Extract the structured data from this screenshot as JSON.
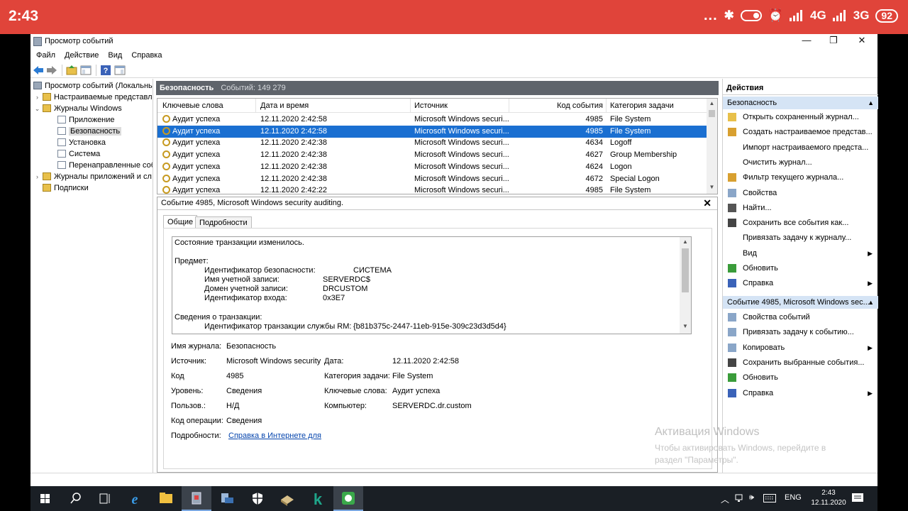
{
  "phone": {
    "time": "2:43",
    "dots": "...",
    "net1": "4G",
    "net2": "3G",
    "battery": "92"
  },
  "window": {
    "title": "Просмотр событий",
    "minimize": "—",
    "restore": "❐",
    "close": "✕",
    "menu": [
      "Файл",
      "Действие",
      "Вид",
      "Справка"
    ]
  },
  "tree": {
    "root": "Просмотр событий (Локальнь",
    "custom_views": "Настраиваемые представле",
    "windows_logs": "Журналы Windows",
    "application": "Приложение",
    "security": "Безопасность",
    "setup": "Установка",
    "system": "Система",
    "forwarded": "Перенаправленные соб",
    "app_logs": "Журналы приложений и сл",
    "subscriptions": "Подписки"
  },
  "center": {
    "log_name": "Безопасность",
    "events_count": "Событий: 149 279",
    "columns": [
      "Ключевые слова",
      "Дата и время",
      "Источник",
      "Код события",
      "Категория задачи"
    ],
    "rows": [
      {
        "kw": "Аудит успеха",
        "dt": "12.11.2020 2:42:58",
        "src": "Microsoft Windows securi...",
        "id": "4985",
        "cat": "File System"
      },
      {
        "kw": "Аудит успеха",
        "dt": "12.11.2020 2:42:58",
        "src": "Microsoft Windows securi...",
        "id": "4985",
        "cat": "File System"
      },
      {
        "kw": "Аудит успеха",
        "dt": "12.11.2020 2:42:38",
        "src": "Microsoft Windows securi...",
        "id": "4634",
        "cat": "Logoff"
      },
      {
        "kw": "Аудит успеха",
        "dt": "12.11.2020 2:42:38",
        "src": "Microsoft Windows securi...",
        "id": "4627",
        "cat": "Group Membership"
      },
      {
        "kw": "Аудит успеха",
        "dt": "12.11.2020 2:42:38",
        "src": "Microsoft Windows securi...",
        "id": "4624",
        "cat": "Logon"
      },
      {
        "kw": "Аудит успеха",
        "dt": "12.11.2020 2:42:38",
        "src": "Microsoft Windows securi...",
        "id": "4672",
        "cat": "Special Logon"
      },
      {
        "kw": "Аудит успеха",
        "dt": "12.11.2020 2:42:22",
        "src": "Microsoft Windows securi...",
        "id": "4985",
        "cat": "File System"
      }
    ]
  },
  "detail": {
    "title": "Событие 4985, Microsoft Windows security auditing.",
    "close": "✕",
    "tab_general": "Общие",
    "tab_details": "Подробности",
    "message": {
      "line1": "Состояние транзакции изменилось.",
      "subject": "Предмет:",
      "sid_label": "Идентификатор безопасности:",
      "sid_value": "СИСТЕМА",
      "account_label": "Имя учетной записи:",
      "account_value": "SERVERDC$",
      "domain_label": "Домен учетной записи:",
      "domain_value": "DRCUSTOM",
      "logon_label": "Идентификатор входа:",
      "logon_value": "0x3E7",
      "tx_info": "Сведения о транзакции:",
      "tx_label": "Идентификатор транзакции службы RM:",
      "tx_value": "{b81b375c-2447-11eb-915e-309c23d3d5d4}"
    },
    "props": {
      "log_name_label": "Имя журнала:",
      "log_name_value": "Безопасность",
      "source_label": "Источник:",
      "source_value": "Microsoft Windows security",
      "date_label": "Дата:",
      "date_value": "12.11.2020 2:42:58",
      "code_label": "Код",
      "code_value": "4985",
      "category_label": "Категория задачи:",
      "category_value": "File System",
      "level_label": "Уровень:",
      "level_value": "Сведения",
      "keywords_label": "Ключевые слова:",
      "keywords_value": "Аудит успеха",
      "user_label": "Пользов.:",
      "user_value": "Н/Д",
      "computer_label": "Компьютер:",
      "computer_value": "SERVERDC.dr.custom",
      "opcode_label": "Код операции:",
      "opcode_value": "Сведения",
      "more_label": "Подробности:",
      "more_link": "Справка в Интернете для"
    }
  },
  "actions": {
    "title": "Действия",
    "section1": "Безопасность",
    "items1": [
      "Открыть сохраненный журнал...",
      "Создать настраиваемое представ...",
      "Импорт настраиваемого предста...",
      "Очистить журнал...",
      "Фильтр текущего журнала...",
      "Свойства",
      "Найти...",
      "Сохранить все события как...",
      "Привязать задачу к журналу...",
      "Вид",
      "Обновить",
      "Справка"
    ],
    "section2": "Событие 4985, Microsoft Windows sec...",
    "items2": [
      "Свойства событий",
      "Привязать задачу к событию...",
      "Копировать",
      "Сохранить выбранные события...",
      "Обновить",
      "Справка"
    ]
  },
  "watermark": {
    "title": "Активация Windows",
    "line1": "Чтобы активировать Windows, перейдите в",
    "line2": "раздел \"Параметры\"."
  },
  "taskbar": {
    "lang": "ENG",
    "time": "2:43",
    "date": "12.11.2020"
  }
}
